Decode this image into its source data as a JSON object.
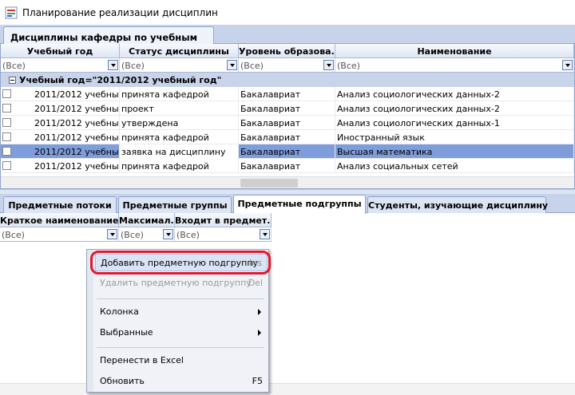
{
  "window": {
    "title": "Планирование реализации дисциплин"
  },
  "top_tab": {
    "label": "Дисциплины кафедры по учебным годам"
  },
  "grid": {
    "columns": [
      "Учебный год",
      "Статус дисциплины",
      "Уровень образова...",
      "Наименование"
    ],
    "filter_value": "(Все)",
    "group_label": "Учебный год=\"2011/2012 учебный год\"",
    "rows": [
      {
        "year": "2011/2012 учебны...",
        "status": "принята кафедрой",
        "level": "Бакалавриат",
        "name": "Анализ социологических данных-2",
        "selected": false
      },
      {
        "year": "2011/2012 учебны...",
        "status": "проект",
        "level": "Бакалавриат",
        "name": "Анализ социологических данных-2",
        "selected": false
      },
      {
        "year": "2011/2012 учебны...",
        "status": "утверждена",
        "level": "Бакалавриат",
        "name": "Анализ социологических данных-1",
        "selected": false
      },
      {
        "year": "2011/2012 учебны...",
        "status": "принята кафедрой",
        "level": "Бакалавриат",
        "name": "Иностранный язык",
        "selected": false
      },
      {
        "year": "2011/2012 учебны...",
        "status": "заявка на дисциплину",
        "level": "Бакалавриат",
        "name": "Высшая математика",
        "selected": true
      },
      {
        "year": "2011/2012 учебны...",
        "status": "принята кафедрой",
        "level": "Бакалавриат",
        "name": "Анализ социальных сетей",
        "selected": false
      }
    ]
  },
  "bottom_tabs": [
    {
      "label": "Предметные потоки",
      "active": false
    },
    {
      "label": "Предметные группы",
      "active": false
    },
    {
      "label": "Предметные подгруппы",
      "active": true
    },
    {
      "label": "Студенты, изучающие дисциплину",
      "active": false
    }
  ],
  "sub_grid": {
    "columns": [
      "Краткое наименование",
      "Максимал...",
      "Входит в предмет..."
    ],
    "filter_value": "(Все)"
  },
  "context_menu": {
    "items": [
      {
        "label": "Добавить предметную подгруппу",
        "shortcut": "Ins",
        "disabled": false,
        "submenu": false
      },
      {
        "label": "Удалить предметную подгруппу",
        "shortcut": "Del",
        "disabled": true,
        "submenu": false
      },
      {
        "label": "Колонка",
        "shortcut": "",
        "disabled": false,
        "submenu": true
      },
      {
        "label": "Выбранные",
        "shortcut": "",
        "disabled": false,
        "submenu": true
      },
      {
        "label": "Перенести в Excel",
        "shortcut": "",
        "disabled": false,
        "submenu": false
      },
      {
        "label": "Обновить",
        "shortcut": "F5",
        "disabled": false,
        "submenu": false
      }
    ]
  },
  "colors": {
    "accent": "#e3182d",
    "selection": "#7f9ddb",
    "tab_strip": "#c6d3ea"
  }
}
